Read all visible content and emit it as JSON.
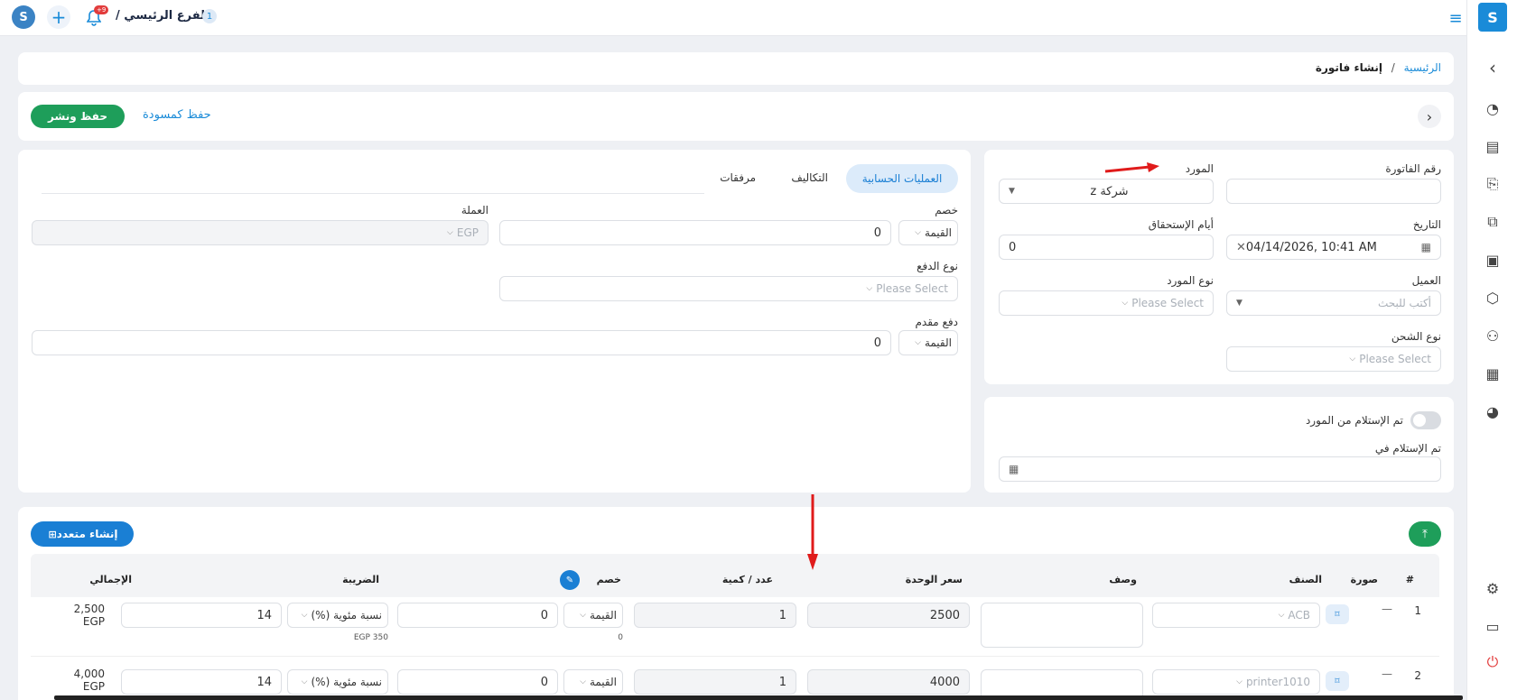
{
  "topbar": {
    "branch_count": "1",
    "branch_name": "الفرع الرئيسي /",
    "notification_count": "+9"
  },
  "breadcrumb": {
    "home": "الرئيسية",
    "separator": "/",
    "current": "إنشاء فاتورة"
  },
  "actions": {
    "save_publish": "حفظ ونشر",
    "save_draft": "حفظ كمسودة"
  },
  "invoice": {
    "invoice_number_label": "رقم الفاتورة",
    "invoice_number_value": "",
    "supplier_label": "المورد",
    "supplier_value": "شركة z",
    "date_label": "التاريخ",
    "date_value": "04/14/2026, 10:41 AM",
    "due_days_label": "أيام الإستحقاق",
    "due_days_value": "0",
    "client_label": "العميل",
    "client_placeholder": "أكتب للبحث",
    "supplier_type_label": "نوع المورد",
    "supplier_type_placeholder": "Please Select",
    "shipping_type_label": "نوع الشحن",
    "shipping_type_placeholder": "Please Select"
  },
  "receipt": {
    "received_label": "تم الإستلام من المورد",
    "received_on_label": "تم الإستلام في"
  },
  "tabs": {
    "accounting": "العمليات الحسابية",
    "costs": "التكاليف",
    "attachments": "مرفقات"
  },
  "accounting": {
    "discount_label": "خصم",
    "discount_type": "القيمة",
    "discount_value": "0",
    "currency_label": "العملة",
    "currency_value": "EGP",
    "payment_type_label": "نوع الدفع",
    "payment_type_placeholder": "Please Select",
    "advance_label": "دفع مقدم",
    "advance_type": "القيمة",
    "advance_value": "0"
  },
  "items": {
    "create_multiple": "إنشاء متعدد",
    "headers": {
      "num": "#",
      "image": "صورة",
      "item": "الصنف",
      "description": "وصف",
      "unit_price": "سعر الوحدة",
      "qty": "عدد / كمية",
      "discount": "خصم",
      "tax": "الضريبة",
      "total": "الإجمالي"
    },
    "rows": [
      {
        "num": "1",
        "image": "—",
        "item": "ACB",
        "unit_price": "2500",
        "qty": "1",
        "discount_type": "القيمة",
        "discount_value": "0",
        "discount_note": "0",
        "tax_type": "نسبة مئوية (%)",
        "tax_value": "14",
        "tax_note": "EGP 350",
        "total": "2,500",
        "total_currency": "EGP"
      },
      {
        "num": "2",
        "image": "—",
        "item": "printer1010",
        "unit_price": "4000",
        "qty": "1",
        "discount_type": "القيمة",
        "discount_value": "0",
        "tax_type": "نسبة مئوية (%)",
        "tax_value": "14",
        "total": "4,000",
        "total_currency": "EGP"
      }
    ]
  },
  "colors": {
    "primary": "#1a8bd8",
    "green": "#1e9e5a",
    "arrow": "#e01b1b"
  }
}
